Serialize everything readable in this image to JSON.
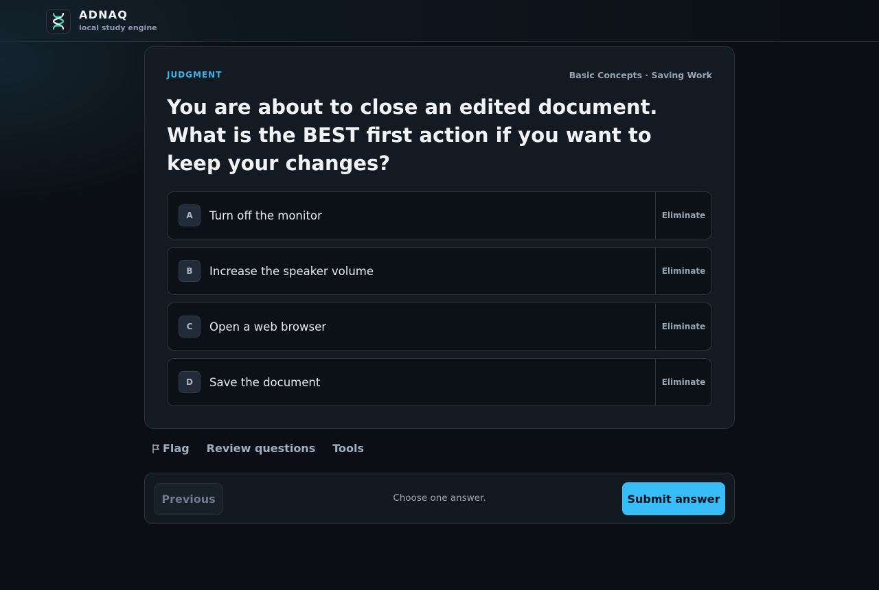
{
  "header": {
    "brand_name": "ADNAQ",
    "brand_tagline": "local study engine",
    "logo_icon": "dna-helix-icon"
  },
  "question": {
    "kind": "JUDGMENT",
    "topic": "Basic Concepts · Saving Work",
    "text": "You are about to close an edited document. What is the BEST first action if you want to keep your changes?",
    "choices": [
      {
        "letter": "A",
        "text": "Turn off the monitor",
        "eliminate_label": "Eliminate"
      },
      {
        "letter": "B",
        "text": "Increase the speaker volume",
        "eliminate_label": "Eliminate"
      },
      {
        "letter": "C",
        "text": "Open a web browser",
        "eliminate_label": "Eliminate"
      },
      {
        "letter": "D",
        "text": "Save the document",
        "eliminate_label": "Eliminate"
      }
    ]
  },
  "actions": {
    "flag_label": "Flag",
    "flag_icon": "flag-icon",
    "review_label": "Review questions",
    "tools_label": "Tools"
  },
  "footer": {
    "previous_label": "Previous",
    "hint": "Choose one answer.",
    "submit_label": "Submit answer"
  },
  "colors": {
    "accent": "#38bdf8",
    "background": "#0b0f15",
    "card": "#141a21"
  }
}
